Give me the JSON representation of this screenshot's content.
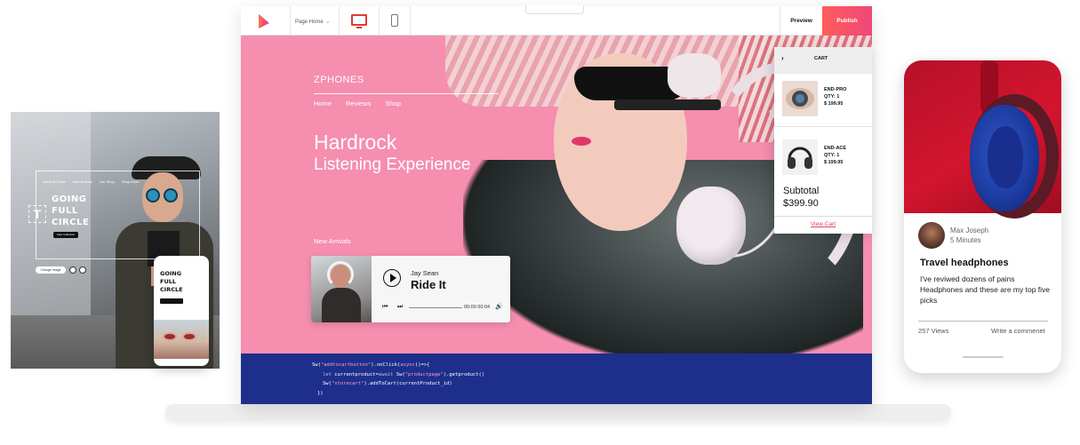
{
  "left_card": {
    "nav": [
      "Sell Full Circle",
      "New Arrivals",
      "Our Story",
      "Shop More"
    ],
    "title": [
      "GOING",
      "FULL",
      "CIRCLE"
    ],
    "button": "View Collection",
    "tool_letter": "T",
    "change_image": "Change Image"
  },
  "mini_phone": {
    "title": [
      "GOING",
      "FULL",
      "CIRCLE"
    ]
  },
  "toolbar": {
    "page_select": "Page Home",
    "preview": "Preview",
    "publish": "Publish",
    "accent": "#f0477a"
  },
  "hero": {
    "brand": "ZPHONES",
    "nav": [
      "Home",
      "Reviews",
      "Shop"
    ],
    "headline1": "Hardrock",
    "headline2": "Listening Experience",
    "section": "New Arrivals",
    "bg_color": "#f58eaf"
  },
  "player": {
    "artist": "Jay Sean",
    "song": "Ride It",
    "time": "00:00 00:04"
  },
  "code": {
    "line1_a": "Sw(",
    "line1_s": "\"addtocartbutton\"",
    "line1_b": ").onClick(",
    "line1_k": "async",
    "line1_c": "()=>{",
    "line2_k": "let",
    "line2_a": " currentproduct=",
    "line2_k2": "await",
    "line2_b": " Sw(",
    "line2_s": "\"productpage\"",
    "line2_c": ").getproduct()",
    "line3_a": "Sw(",
    "line3_s": "\"storecart\"",
    "line3_b": ").addToCart(currentProduct_id)",
    "line4": "})"
  },
  "cart": {
    "title": "CART",
    "items": [
      {
        "name": "END-PRO",
        "qty": "QTY: 1",
        "price": "$ 199.95"
      },
      {
        "name": "END-ACE",
        "qty": "QTY: 1",
        "price": "$ 199.95"
      }
    ],
    "subtotal_label": "Subtotal",
    "subtotal_value": "$399.90",
    "view_cart": "View Cart"
  },
  "phone": {
    "author": "Max Joseph",
    "time": "5 Minutes",
    "title": "Travel headphones",
    "body": "I've reviwed dozens of pains Headphones and these are my top five picks",
    "views": "257 Views",
    "comment": "Write a commenet"
  }
}
